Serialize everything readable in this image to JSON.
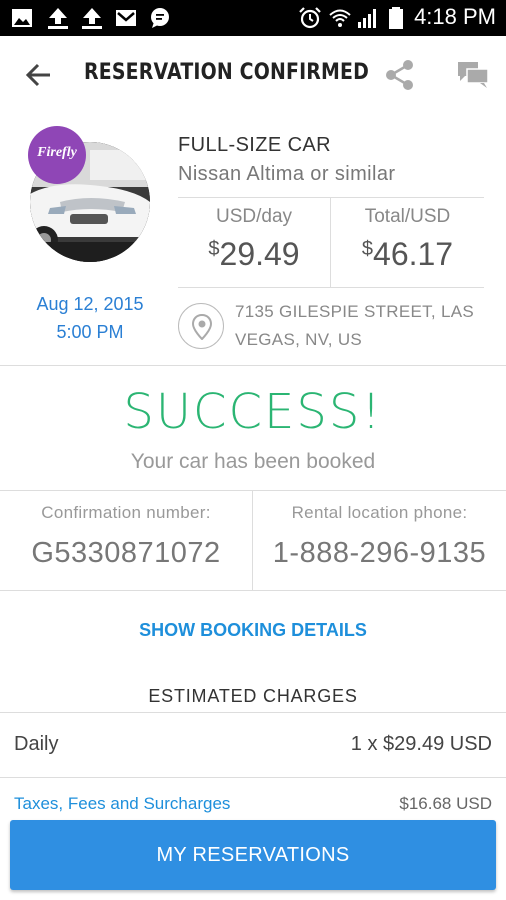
{
  "status_bar": {
    "time": "4:18 PM",
    "left_icons": [
      "image-icon",
      "upload-icon",
      "upload-icon",
      "mail-icon",
      "chat-bubble-icon"
    ],
    "right_icons": [
      "alarm-icon",
      "wifi-icon",
      "signal-icon",
      "battery-icon"
    ]
  },
  "app_bar": {
    "title": "RESERVATION CONFIRMED",
    "icons": [
      "back-arrow-icon",
      "share-icon",
      "chat-icon"
    ]
  },
  "vehicle": {
    "brand_badge": "Firefly",
    "car_class": "FULL-SIZE CAR",
    "car_model": "Nissan Altima or similar",
    "pickup_date": "Aug 12, 2015",
    "pickup_time": "5:00 PM",
    "price": {
      "daily_label": "USD/day",
      "daily_currency_symbol": "$",
      "daily_amount": "29.49",
      "total_label": "Total/USD",
      "total_currency_symbol": "$",
      "total_amount": "46.17"
    },
    "address": "7135 GILESPIE STREET, LAS VEGAS, NV, US"
  },
  "success": {
    "title": "SUCCESS!",
    "subtitle": "Your car has been booked"
  },
  "info": {
    "confirmation_label": "Confirmation number:",
    "confirmation_value": "G5330871072",
    "phone_label": "Rental location phone:",
    "phone_value": "1-888-296-9135"
  },
  "details_link": "SHOW BOOKING DETAILS",
  "charges": {
    "heading": "ESTIMATED CHARGES",
    "rows": [
      {
        "label": "Daily",
        "value": "1 x $29.49 USD"
      },
      {
        "label": "Taxes, Fees and Surcharges",
        "value": "$16.68 USD"
      }
    ]
  },
  "bottom_button": "MY RESERVATIONS",
  "colors": {
    "accent_blue": "#2f8fe2",
    "link_blue": "#1e8fdb",
    "success_green": "#2bb573",
    "brand_purple": "#8f46b6"
  }
}
